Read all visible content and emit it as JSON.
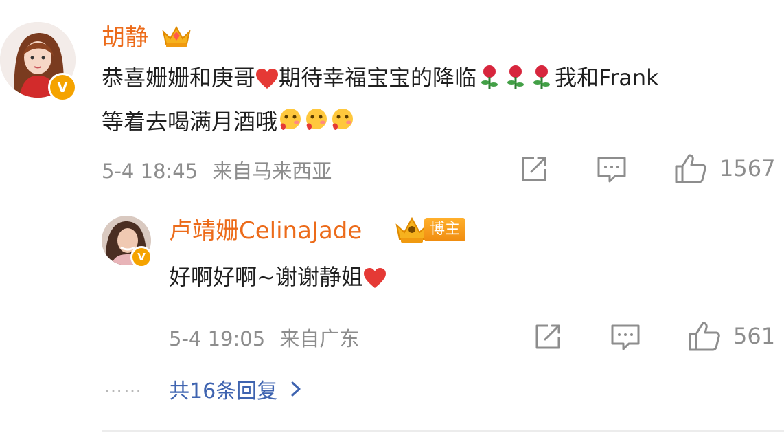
{
  "comment": {
    "username": "胡静",
    "text_line1_a": "恭喜姗姗和庚哥",
    "text_line1_b": "期待幸福宝宝的降临",
    "text_line1_c": "我和Frank",
    "text_line2": "等着去喝满月酒哦",
    "timestamp": "5-4 18:45",
    "location": "来自马来西亚",
    "like_count": "1567"
  },
  "reply": {
    "username": "卢靖姗CelinaJade",
    "tag_label": "博主",
    "text": "好啊好啊~谢谢静姐",
    "timestamp": "5-4 19:05",
    "location": "来自广东",
    "like_count": "561"
  },
  "more_replies": {
    "dots": "……",
    "label": "共16条回复"
  },
  "colors": {
    "username": "#ec6b1a",
    "meta": "#8d8d8d",
    "link": "#3f64b0",
    "badge": "#f5a300"
  },
  "icons": [
    "crown-badge-icon",
    "verified-icon",
    "share-icon",
    "comment-icon",
    "like-icon",
    "heart-emoji",
    "rose-emoji",
    "blush-emoji",
    "chevron-right-icon"
  ]
}
